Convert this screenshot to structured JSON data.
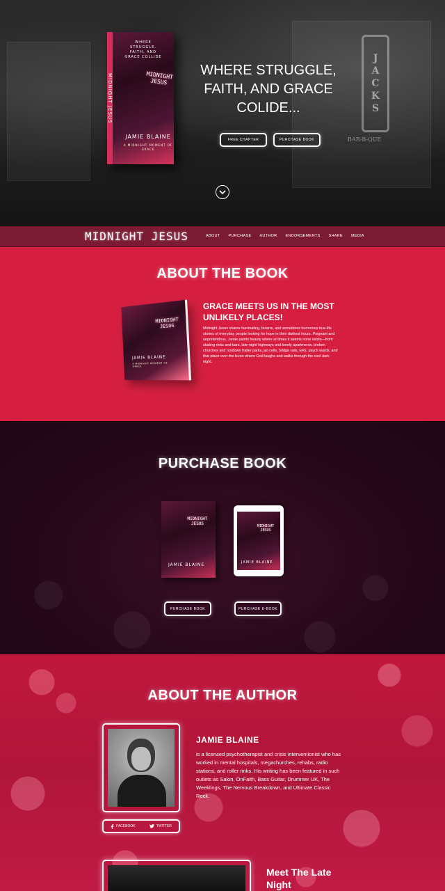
{
  "hero": {
    "headline": "WHERE STRUGGLE, FAITH, AND GRACE COLIDE...",
    "buttons": [
      "FREE CHAPTER",
      "PURCHASE BOOK"
    ],
    "neon_sign": [
      "J",
      "A",
      "C",
      "K",
      "S"
    ],
    "neon_sub": "BAR-B-QUE",
    "book": {
      "top_text": "WHERE STRUGGLE, FAITH, AND GRACE COLLIDE",
      "title": "MIDNIGHT JESUS",
      "author": "JAMIE BLAINE",
      "subtitle": "A MIDNIGHT MOMENT OF GRACE",
      "spine": "MIDNIGHT JESUS"
    }
  },
  "nav": {
    "brand": "MIDNIGHT JESUS",
    "links": [
      "ABOUT",
      "PURCHASE",
      "AUTHOR",
      "ENDORSEMENTS",
      "SHARE",
      "MEDIA"
    ]
  },
  "about": {
    "title": "ABOUT THE BOOK",
    "subtitle": "GRACE MEETS US IN THE MOST UNLIKELY PLACES!",
    "body": "Midnight Jesus shares fascinating, bizarre, and sometimes humorous true-life stories of everyday people looking for hope in their darkest hours. Poignant and unpretentious, Jamie paints beauty where at times it seems none exists—from skating rinks and bars, late-night highways and lonely apartments, broken churches and rundown trailer parks, jail cells, bridge rails, ERs, psych wards, and that place over the levee where God laughs and walks through the cool dark night."
  },
  "purchase": {
    "title": "PURCHASE BOOK",
    "buttons": [
      "PURCHASE BOOK",
      "PURCHASE E-BOOK"
    ]
  },
  "author": {
    "title": "ABOUT THE AUTHOR",
    "name": "JAMIE BLAINE",
    "bio": "is a licensed psychotherapist and crisis interventionist who has worked in mental hospitals, megachurches, rehabs, radio stations, and roller rinks. His writing has been featured in such outlets as Salon, OnFaith, Bass Guitar, Drummer UK, The Weeklings, The Nervous Breakdown, and Ultimate Classic Rock.",
    "social": [
      "FACEBOOK",
      "TWITTER"
    ],
    "next_title": "Meet The Late Night"
  },
  "colors": {
    "nav_bg": "#7a1b33",
    "about_bg": "#d61f40",
    "purchase_bg": "#250818",
    "author_bg": "#c0183c"
  }
}
